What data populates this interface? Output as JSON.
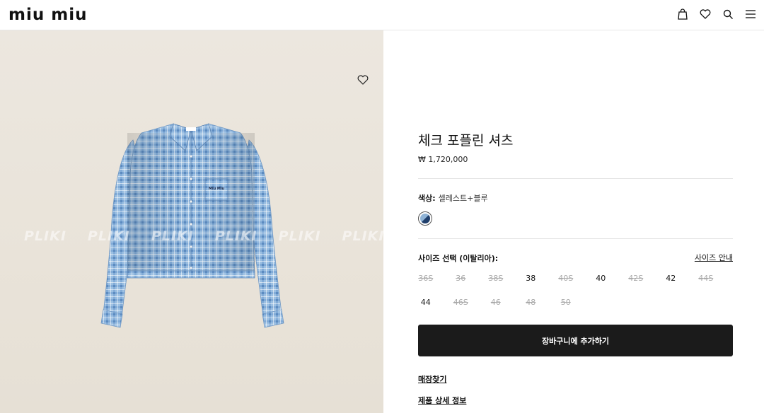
{
  "header": {
    "logo": "miu miu",
    "icons": [
      "bag-icon",
      "heart-icon",
      "search-icon",
      "menu-icon"
    ]
  },
  "image": {
    "watermark": [
      "PLIKI",
      "PLIKI",
      "PLIKI",
      "PLIKI",
      "PLIKI",
      "PLIKI"
    ],
    "shirt_label": "Miu Miu"
  },
  "product": {
    "title": "체크 포플린 셔츠",
    "price": "₩ 1,720,000",
    "color_label": "색상:",
    "color_value": "셀레스트+블루",
    "size_label": "사이즈 선택 (이탈리아):",
    "size_guide": "사이즈 안내",
    "sizes": [
      {
        "label": "36S",
        "available": false
      },
      {
        "label": "36",
        "available": false
      },
      {
        "label": "38S",
        "available": false
      },
      {
        "label": "38",
        "available": true
      },
      {
        "label": "40S",
        "available": false
      },
      {
        "label": "40",
        "available": true
      },
      {
        "label": "42S",
        "available": false
      },
      {
        "label": "42",
        "available": true
      },
      {
        "label": "44S",
        "available": false
      },
      {
        "label": "44",
        "available": true
      },
      {
        "label": "46S",
        "available": false
      },
      {
        "label": "46",
        "available": false
      },
      {
        "label": "48",
        "available": false
      },
      {
        "label": "50",
        "available": false
      }
    ],
    "add_to_cart": "장바구니에 추가하기",
    "find_store": "매장찾기",
    "details": "제품 상세 정보"
  },
  "colors": {
    "button_bg": "#1b1b1b",
    "image_bg": "#ebe6dd",
    "shirt_blue": "#8fb6dc"
  }
}
